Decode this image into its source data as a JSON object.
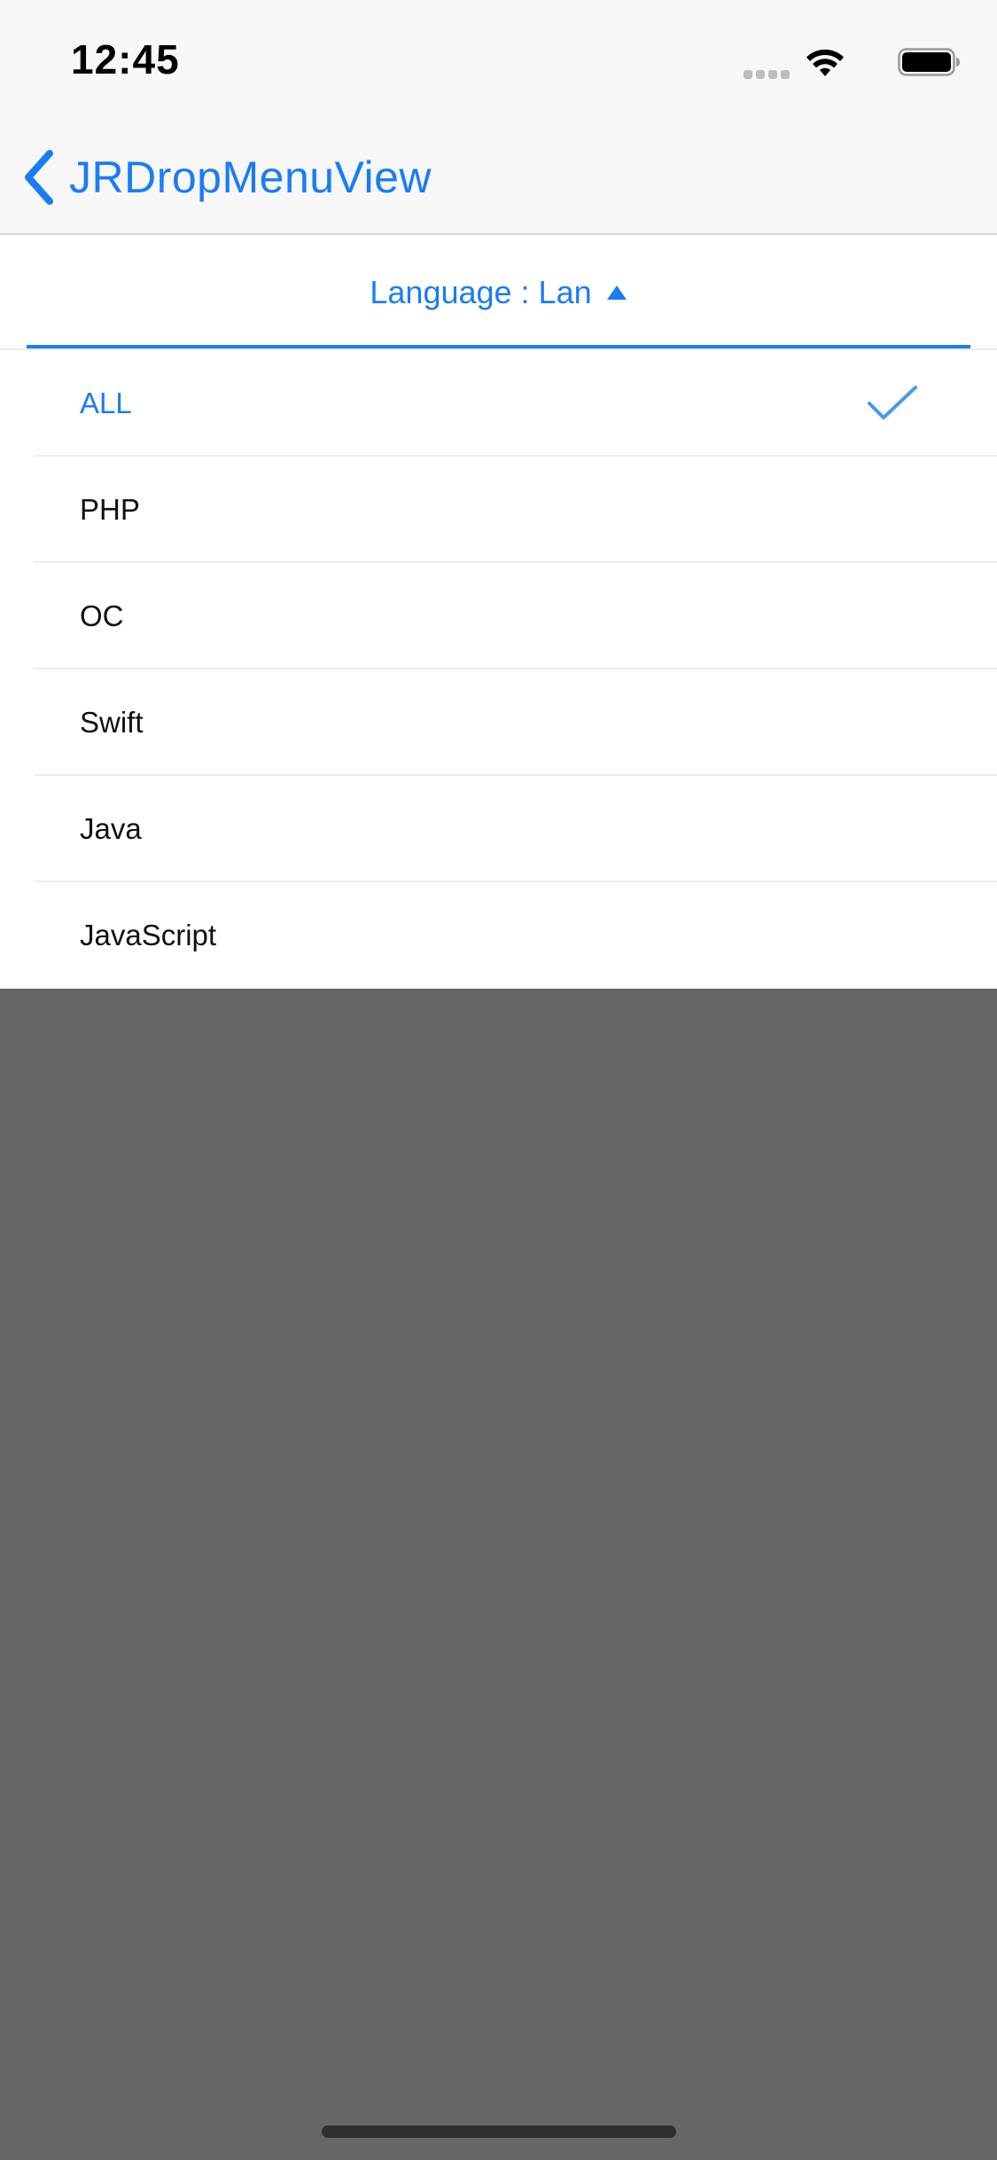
{
  "status_bar": {
    "time": "12:45",
    "signal_icon": "signal-dots-icon",
    "wifi_icon": "wifi-icon",
    "battery_icon": "battery-icon"
  },
  "nav": {
    "back_icon": "chevron-left-icon",
    "title": "JRDropMenuView",
    "accent_color": "#1a7cf5"
  },
  "filter": {
    "label": "Language : Lan",
    "arrow_icon": "triangle-up-icon"
  },
  "menu": {
    "items": [
      {
        "label": "ALL",
        "selected": true
      },
      {
        "label": "PHP",
        "selected": false
      },
      {
        "label": "OC",
        "selected": false
      },
      {
        "label": "Swift",
        "selected": false
      },
      {
        "label": "Java",
        "selected": false
      },
      {
        "label": "JavaScript",
        "selected": false
      }
    ],
    "check_icon": "checkmark-icon"
  },
  "colors": {
    "accent": "#1a7cf5",
    "overlay": "#676767",
    "separator": "#ececec",
    "navbar_bg": "#f7f7f7"
  }
}
